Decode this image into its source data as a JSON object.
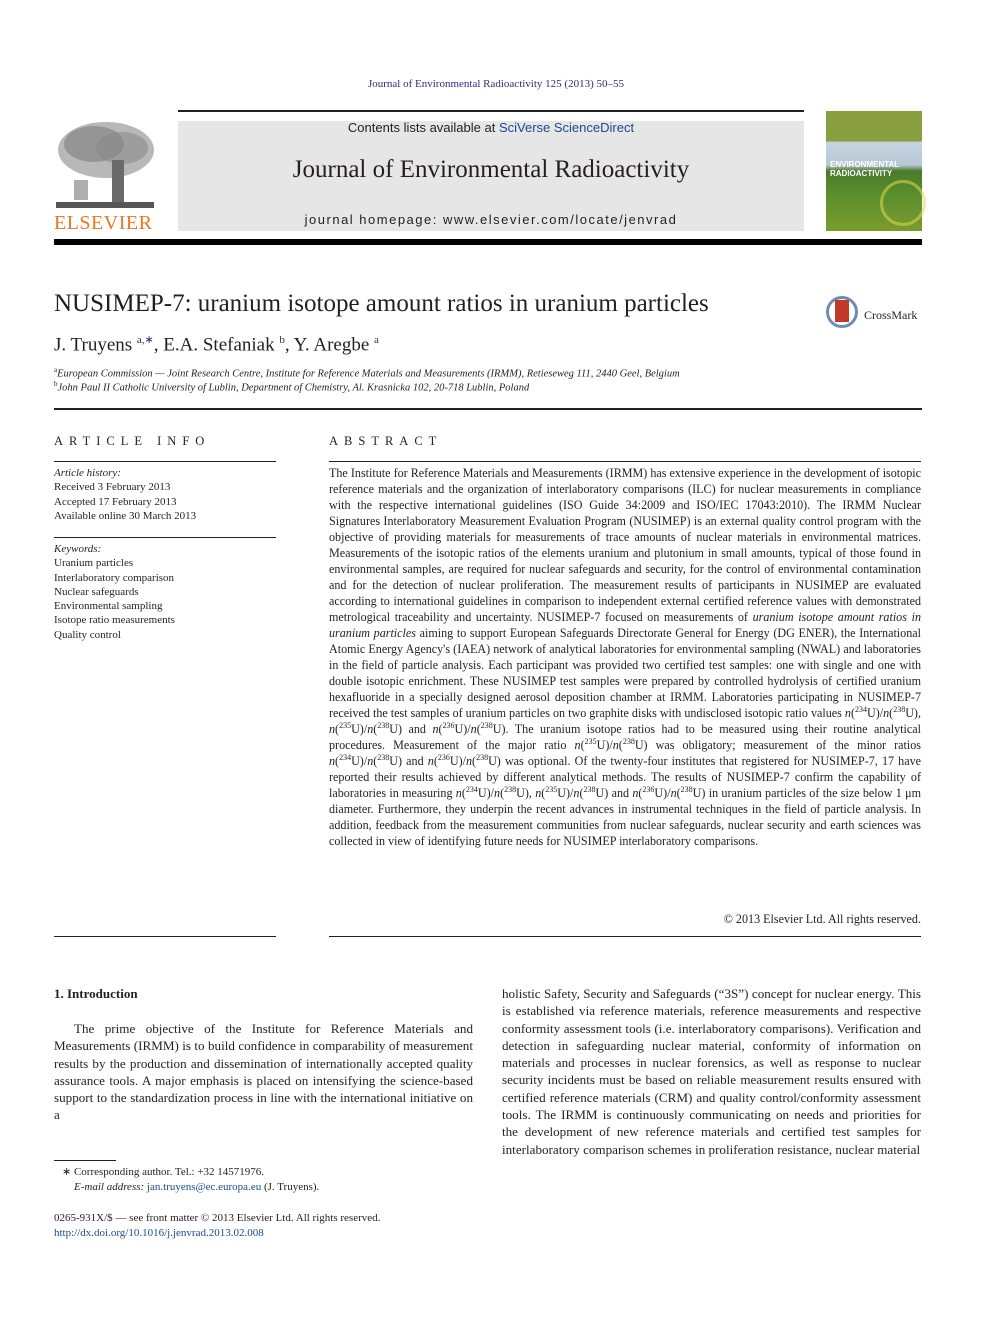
{
  "journal_reference": "Journal of Environmental Radioactivity 125 (2013) 50–55",
  "masthead": {
    "contents_prefix": "Contents lists available at ",
    "contents_link": "SciVerse ScienceDirect",
    "journal_title": "Journal of Environmental Radioactivity",
    "homepage": "journal homepage: www.elsevier.com/locate/jenvrad",
    "publisher_logo_text": "ELSEVIER",
    "cover_title_line1": "ENVIRONMENTAL",
    "cover_title_line2": "RADIOACTIVITY",
    "colors": {
      "publisher_orange": "#e87722",
      "link_blue": "#1a4b8c",
      "masthead_gray": "#e6e6e6"
    }
  },
  "article": {
    "title": "NUSIMEP-7: uranium isotope amount ratios in uranium particles",
    "crossmark_label": "CrossMark",
    "authors": [
      {
        "name": "J. Truyens",
        "sup": "a,∗",
        "sep": ", "
      },
      {
        "name": "E.A. Stefaniak",
        "sup": "b",
        "sep": ", "
      },
      {
        "name": "Y. Aregbe",
        "sup": "a",
        "sep": ""
      }
    ],
    "affiliations": [
      {
        "mark": "a",
        "text": "European Commission — Joint Research Centre, Institute for Reference Materials and Measurements (IRMM), Retieseweg 111, 2440 Geel, Belgium"
      },
      {
        "mark": "b",
        "text": "John Paul II Catholic University of Lublin, Department of Chemistry, Al. Krasnicka 102, 20-718 Lublin, Poland"
      }
    ]
  },
  "article_info": {
    "heading": "ARTICLE INFO",
    "history_label": "Article history:",
    "history": [
      "Received 3 February 2013",
      "Accepted 17 February 2013",
      "Available online 30 March 2013"
    ],
    "keywords_label": "Keywords:",
    "keywords": [
      "Uranium particles",
      "Interlaboratory comparison",
      "Nuclear safeguards",
      "Environmental sampling",
      "Isotope ratio measurements",
      "Quality control"
    ]
  },
  "abstract": {
    "heading": "ABSTRACT",
    "p1": "The Institute for Reference Materials and Measurements (IRMM) has extensive experience in the development of isotopic reference materials and the organization of interlaboratory comparisons (ILC) for nuclear measurements in compliance with the respective international guidelines (ISO Guide 34:2009 and ISO/IEC 17043:2010). The IRMM Nuclear Signatures Interlaboratory Measurement Evaluation Program (NUSIMEP) is an external quality control program with the objective of providing materials for measurements of trace amounts of nuclear materials in environmental matrices. Measurements of the isotopic ratios of the elements uranium and plutonium in small amounts, typical of those found in environmental samples, are required for nuclear safeguards and security, for the control of environmental contamination and for the detection of nuclear proliferation. The measurement results of participants in NUSIMEP are evaluated according to international guidelines in comparison to independent external certified reference values with demonstrated metrological traceability and uncertainty. NUSIMEP-7 focused on measurements of ",
    "p1_italic": "uranium isotope amount ratios in uranium particles",
    "p2": " aiming to support European Safeguards Directorate General for Energy (DG ENER), the International Atomic Energy Agency's (IAEA) network of analytical laboratories for environmental sampling (NWAL) and laboratories in the field of particle analysis. Each participant was provided two certified test samples: one with single and one with double isotopic enrichment. These NUSIMEP test samples were prepared by controlled hydrolysis of certified uranium hexafluoride in a specially designed aerosol deposition chamber at IRMM. Laboratories participating in NUSIMEP-7 received the test samples of uranium particles on two graphite disks with undisclosed isotopic ratio values ",
    "p3": ". The uranium isotope ratios had to be measured using their routine analytical procedures. Measurement of the major ratio ",
    "p4": " was obligatory; measurement of the minor ratios ",
    "p5": " was optional. Of the twenty-four institutes that registered for NUSIMEP-7, 17 have reported their results achieved by different analytical methods. The results of NUSIMEP-7 confirm the capability of laboratories in measuring ",
    "p6": " in uranium particles of the size below 1 μm diameter. Furthermore, they underpin the recent advances in instrumental techniques in the field of particle analysis. In addition, feedback from the measurement communities from nuclear safeguards, nuclear security and earth sciences was collected in view of identifying future needs for NUSIMEP interlaboratory comparisons.",
    "and": " and ",
    "comma": ", ",
    "iso": {
      "n": "n",
      "u": "U)",
      "open": "(",
      "slash": "/",
      "m234": "234",
      "m235": "235",
      "m236": "236",
      "m238": "238"
    },
    "copyright": "© 2013 Elsevier Ltd. All rights reserved."
  },
  "introduction": {
    "heading": "1.  Introduction",
    "left_text": "The prime objective of the Institute for Reference Materials and Measurements (IRMM) is to build confidence in comparability of measurement results by the production and dissemination of internationally accepted quality assurance tools. A major emphasis is placed on intensifying the science-based support to the standardization process in line with the international initiative on a",
    "right_text": "holistic Safety, Security and Safeguards (“3S”) concept for nuclear energy. This is established via reference materials, reference measurements and respective conformity assessment tools (i.e. interlaboratory comparisons). Verification and detection in safeguarding nuclear material, conformity of information on materials and processes in nuclear forensics, as well as response to nuclear security incidents must be based on reliable measurement results ensured with certified reference materials (CRM) and quality control/conformity assessment tools. The IRMM is continuously communicating on needs and priorities for the development of new reference materials and certified test samples for interlaboratory comparison schemes in proliferation resistance, nuclear material"
  },
  "footnotes": {
    "corresponding": "∗  Corresponding author. Tel.: +32 14571976.",
    "email_label": "E-mail address:",
    "email": "jan.truyens@ec.europa.eu",
    "email_suffix": " (J. Truyens).",
    "issn_line": "0265-931X/$ — see front matter © 2013 Elsevier Ltd. All rights reserved.",
    "doi": "http://dx.doi.org/10.1016/j.jenvrad.2013.02.008"
  }
}
